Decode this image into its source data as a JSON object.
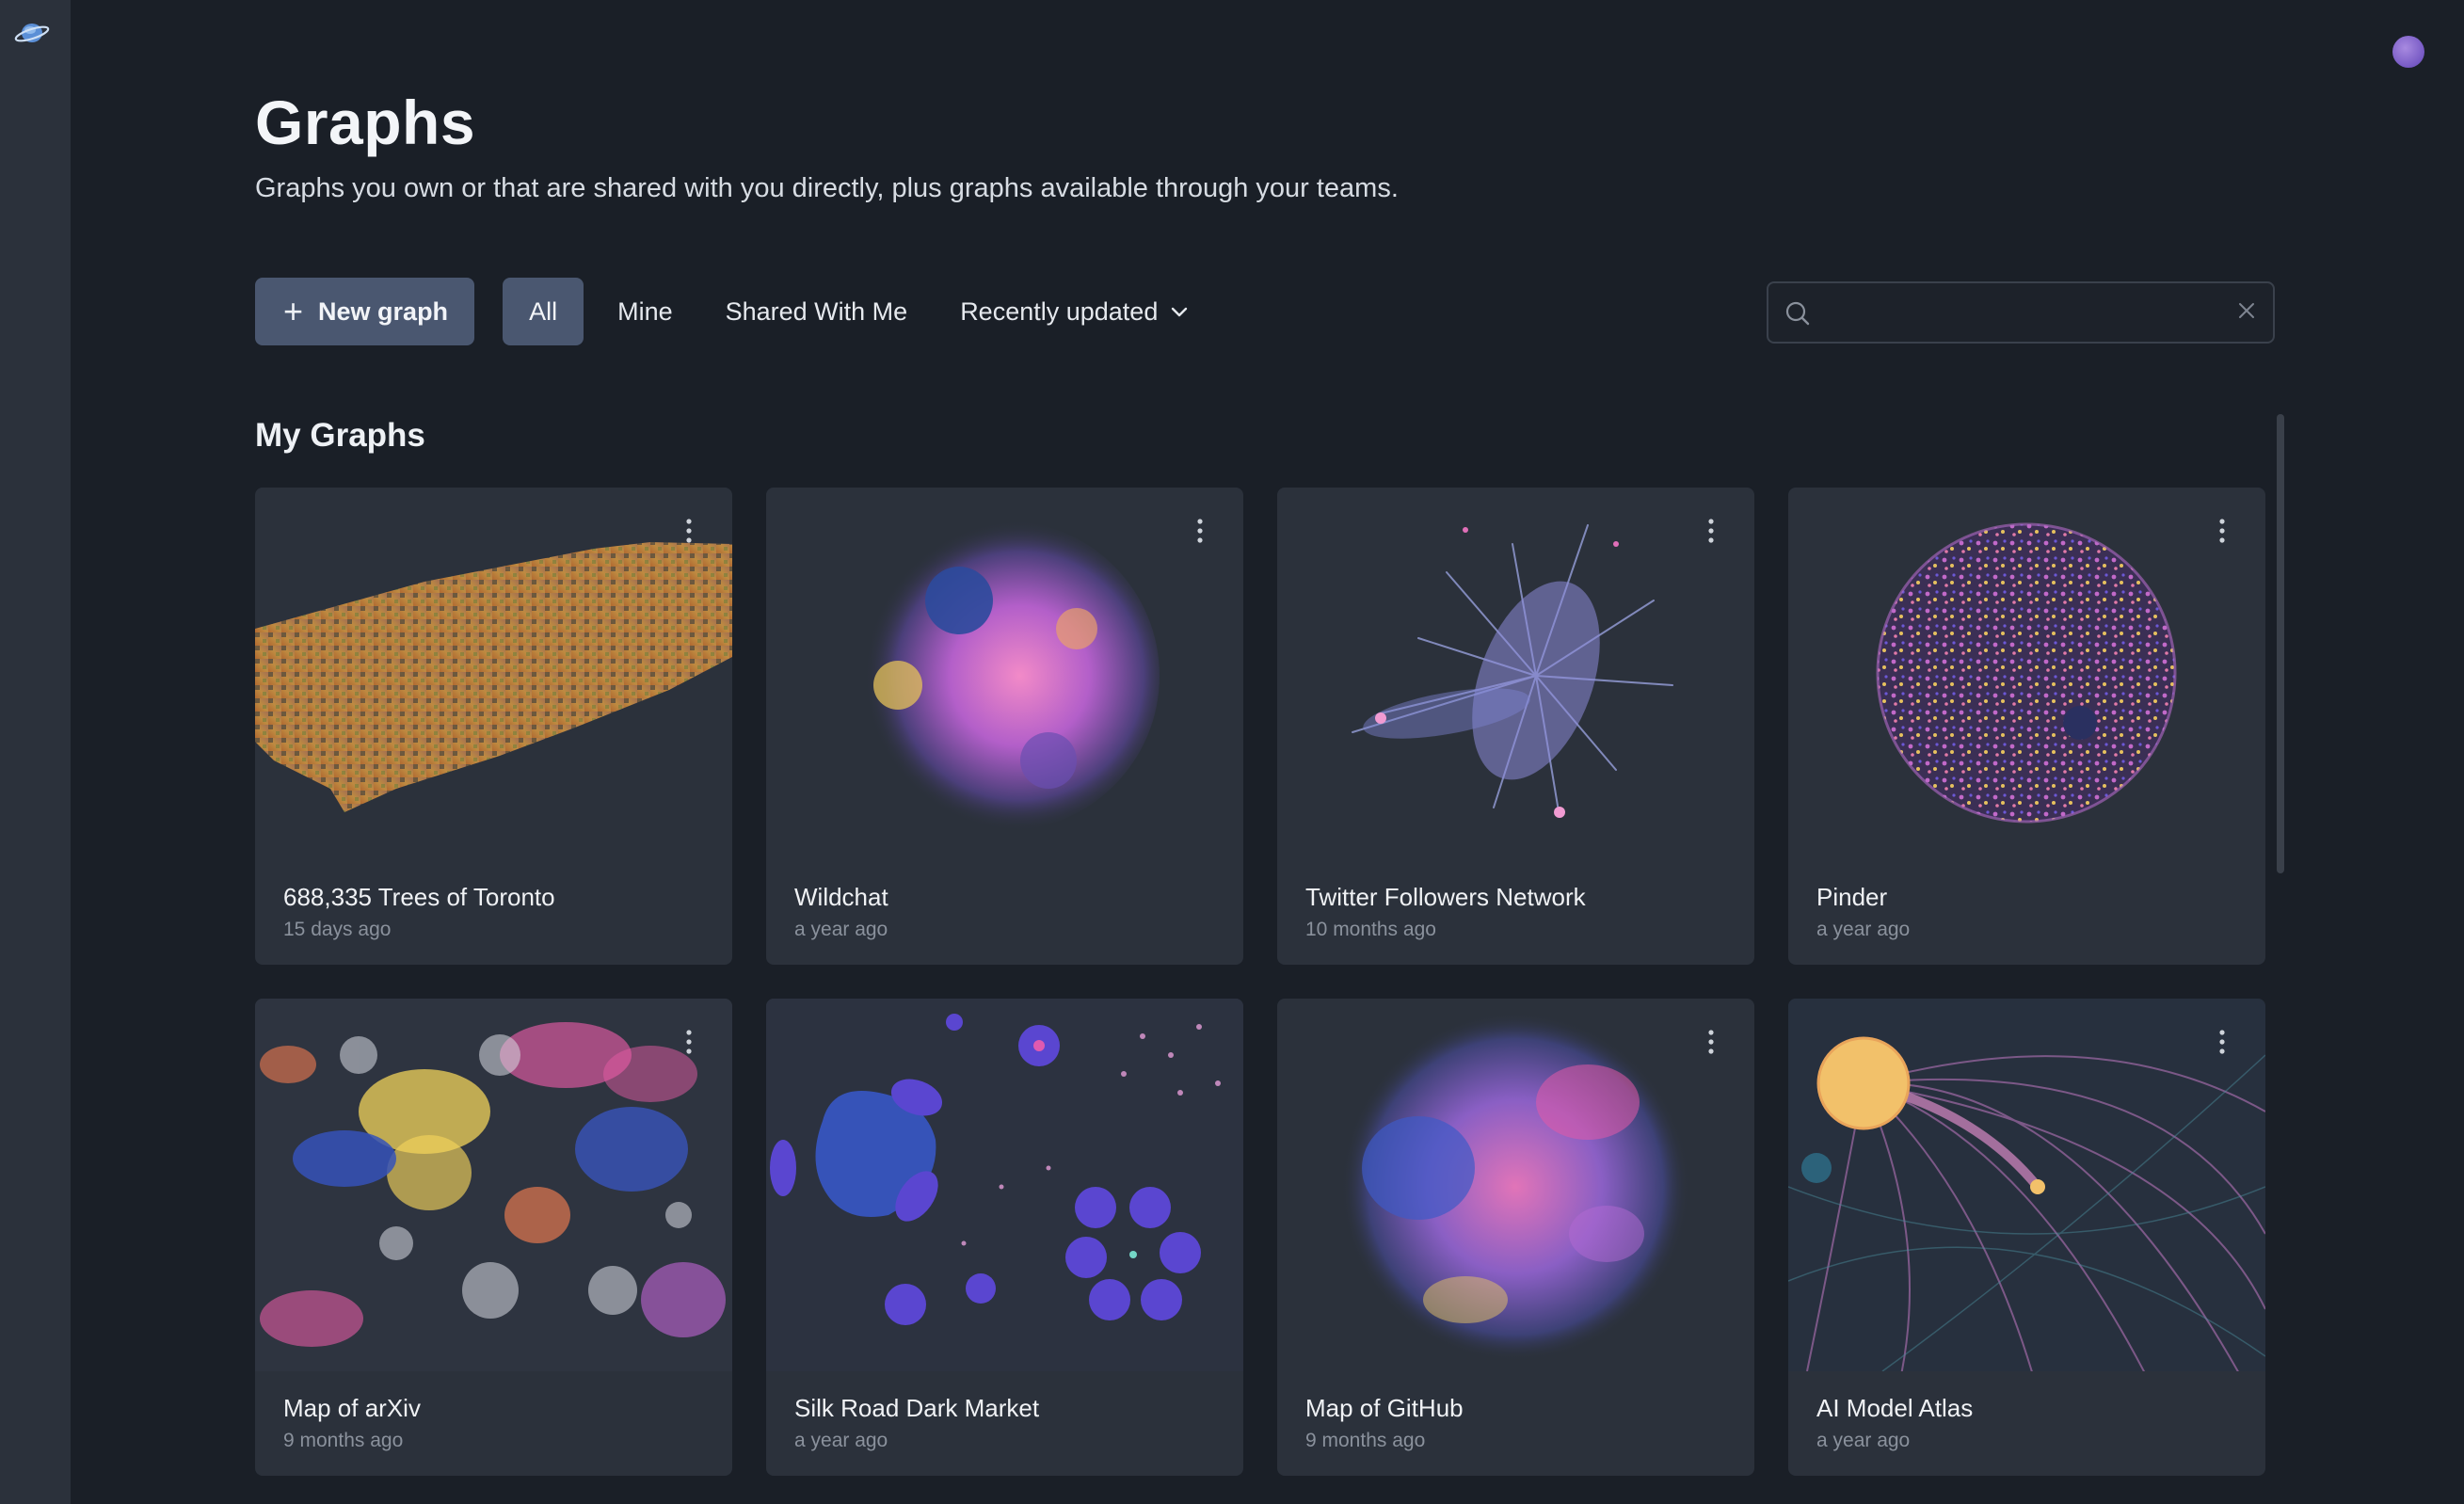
{
  "header": {
    "title": "Graphs",
    "subtitle": "Graphs you own or that are shared with you directly, plus graphs available through your teams."
  },
  "toolbar": {
    "new_graph_label": "New graph",
    "filters": [
      "All",
      "Mine",
      "Shared With Me"
    ],
    "active_filter": "All",
    "sort_label": "Recently updated"
  },
  "search": {
    "value": "",
    "placeholder": ""
  },
  "section": {
    "title": "My Graphs"
  },
  "cards": [
    {
      "title": "688,335 Trees of Toronto",
      "updated": "15 days ago"
    },
    {
      "title": "Wildchat",
      "updated": "a year ago"
    },
    {
      "title": "Twitter Followers Network",
      "updated": "10 months ago"
    },
    {
      "title": "Pinder",
      "updated": "a year ago"
    },
    {
      "title": "Map of arXiv",
      "updated": "9 months ago"
    },
    {
      "title": "Silk Road Dark Market",
      "updated": "a year ago"
    },
    {
      "title": "Map of GitHub",
      "updated": "9 months ago"
    },
    {
      "title": "AI Model Atlas",
      "updated": "a year ago"
    }
  ],
  "colors": {
    "background": "#1a1f27",
    "sidebar": "#2b313b",
    "card": "#2b313b",
    "button": "#4a5770",
    "muted_text": "#8a919c",
    "avatar": "#8a6ad6"
  },
  "icons": [
    "planet-logo-icon",
    "avatar",
    "plus-icon",
    "chevron-down-icon",
    "search-icon",
    "close-icon",
    "kebab-menu-icon"
  ]
}
